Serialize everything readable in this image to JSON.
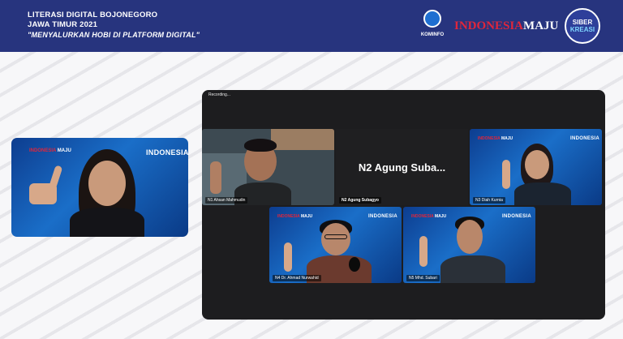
{
  "banner": {
    "title_line1": "LITERASI DIGITAL BOJONEGORO",
    "title_line2": "JAWA TIMUR 2021",
    "title_line3": "\"MENYALURKAN HOBI DI PLATFORM DIGITAL\"",
    "logos": {
      "kominfo": "KOMINFO",
      "indonesia_maju_a": "INDONESIA",
      "indonesia_maju_b": "MAJU",
      "siberkreasi_1": "SIBER",
      "siberkreasi_2": "KREASI"
    }
  },
  "featured_tile": {
    "badge": "INDONESIA"
  },
  "meeting": {
    "recording_label": "Recording...",
    "participants": [
      {
        "name": "N1 Ahsan Mahmudin",
        "badge": ""
      },
      {
        "name": "N2 Agung Subagyo",
        "display_name": "N2 Agung Suba...",
        "camera": "off"
      },
      {
        "name": "N3 Diah Kurnia",
        "badge": "INDONESIA"
      },
      {
        "name": "N4 Dr. Ahmad Nurwahid",
        "badge": "INDONESIA"
      },
      {
        "name": "N5 Mhd. Subari",
        "badge": "INDONESIA"
      }
    ]
  },
  "colors": {
    "banner": "#27347e",
    "meeting_bg": "#1d1d1f",
    "tile_blue": "#1a6ec8",
    "accent_red": "#e0263b"
  }
}
